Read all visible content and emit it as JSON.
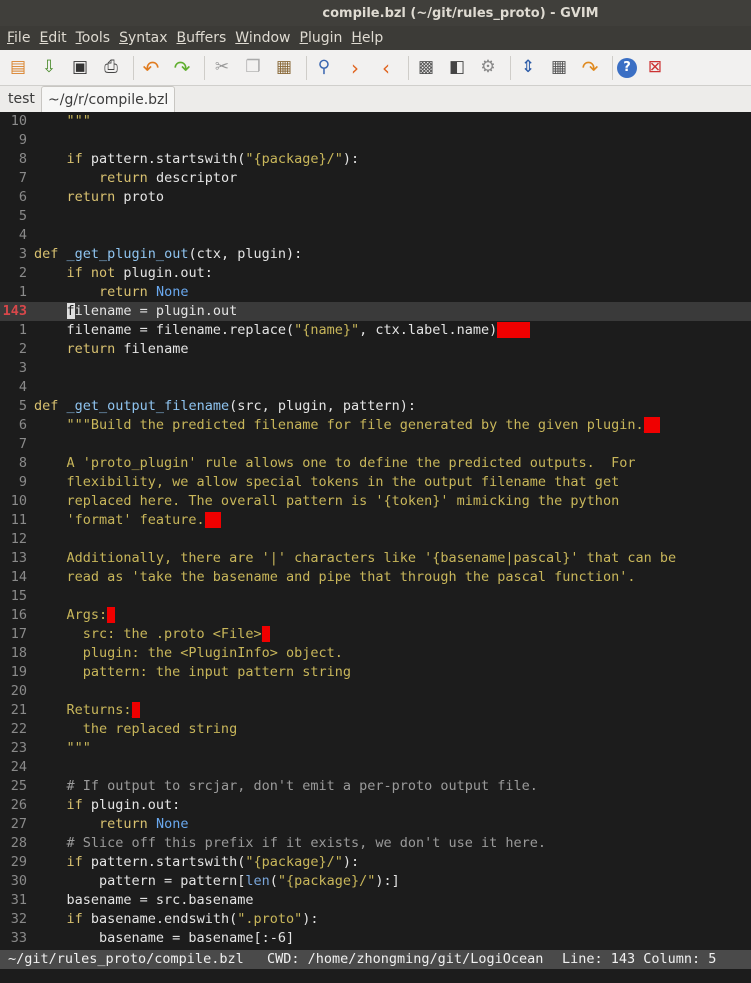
{
  "window": {
    "title": "compile.bzl (~/git/rules_proto) - GVIM"
  },
  "menu": [
    {
      "label_u": "F",
      "label_rest": "ile"
    },
    {
      "label_u": "E",
      "label_rest": "dit"
    },
    {
      "label_u": "T",
      "label_rest": "ools"
    },
    {
      "label_u": "S",
      "label_rest": "yntax"
    },
    {
      "label_u": "B",
      "label_rest": "uffers"
    },
    {
      "label_u": "W",
      "label_rest": "indow"
    },
    {
      "label_u": "P",
      "label_rest": "lugin"
    },
    {
      "label_u": "H",
      "label_rest": "elp"
    }
  ],
  "tabs": [
    {
      "label": "test"
    },
    {
      "label": "~/g/r/compile.bzl"
    }
  ],
  "status": {
    "file": "~/git/rules_proto/compile.bzl",
    "cwd": "CWD: /home/zhongming/git/LogiOcean",
    "position": "Line: 143 Column: 5"
  },
  "colors": {
    "accent_trailing_ws": "#f00000",
    "current_line_number": "#d7474a",
    "keyword": "#d8c170"
  }
}
